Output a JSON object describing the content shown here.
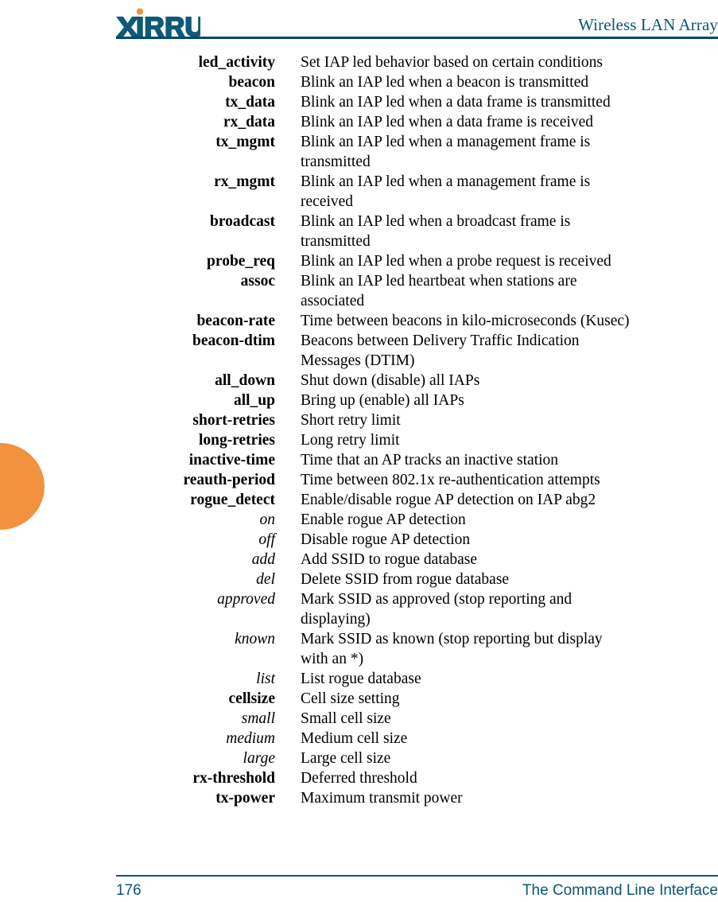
{
  "header": {
    "logo_text": "XIRRUS",
    "logo_icon": "xirrus-wordmark",
    "title": "Wireless LAN Array",
    "rule_color": "#004a63",
    "logo_color": "#0d5a77",
    "logo_dot_color": "#f2913e"
  },
  "decoration": {
    "thumb_tab_color": "#f2913e",
    "thumb_tab_name": "chapter-thumb-tab"
  },
  "content": {
    "entries": [
      {
        "term": "led_activity",
        "level": 1,
        "lines": [
          "Set IAP led behavior based on certain conditions"
        ]
      },
      {
        "term": "beacon",
        "level": 1,
        "lines": [
          "Blink an IAP led when a beacon is transmitted"
        ]
      },
      {
        "term": "tx_data",
        "level": 1,
        "lines": [
          "Blink an IAP led when a data frame is transmitted"
        ]
      },
      {
        "term": "rx_data",
        "level": 1,
        "lines": [
          "Blink an IAP led when a data frame is received"
        ]
      },
      {
        "term": "tx_mgmt",
        "level": 1,
        "lines": [
          "Blink an IAP led when a management frame is",
          "transmitted"
        ]
      },
      {
        "term": "rx_mgmt",
        "level": 1,
        "lines": [
          "Blink an IAP led when a management frame is",
          "received"
        ]
      },
      {
        "term": "broadcast",
        "level": 1,
        "lines": [
          "Blink an IAP led when a broadcast frame is",
          "transmitted"
        ]
      },
      {
        "term": "probe_req",
        "level": 1,
        "lines": [
          "Blink an IAP led when a probe request is received"
        ]
      },
      {
        "term": "assoc",
        "level": 1,
        "lines": [
          "Blink an IAP led heartbeat when stations are",
          "associated"
        ]
      },
      {
        "term": "beacon-rate",
        "level": 1,
        "lines": [
          "Time between beacons in kilo-microseconds (Kusec)"
        ]
      },
      {
        "term": "beacon-dtim",
        "level": 1,
        "lines": [
          "Beacons between Delivery Traffic Indication",
          "Messages (DTIM)"
        ]
      },
      {
        "term": "all_down",
        "level": 1,
        "lines": [
          "Shut down (disable) all IAPs"
        ]
      },
      {
        "term": "all_up",
        "level": 1,
        "lines": [
          "Bring up (enable) all IAPs"
        ]
      },
      {
        "term": "short-retries",
        "level": 1,
        "lines": [
          "Short retry limit"
        ]
      },
      {
        "term": "long-retries",
        "level": 1,
        "lines": [
          "Long retry limit"
        ]
      },
      {
        "term": "inactive-time",
        "level": 1,
        "lines": [
          "Time that an AP tracks an inactive station"
        ]
      },
      {
        "term": "reauth-period",
        "level": 1,
        "lines": [
          "Time between 802.1x re-authentication attempts"
        ]
      },
      {
        "term": "rogue_detect",
        "level": 1,
        "lines": [
          "Enable/disable rogue AP detection on IAP abg2"
        ]
      },
      {
        "term": "on",
        "level": 2,
        "lines": [
          "Enable rogue AP detection"
        ]
      },
      {
        "term": "off",
        "level": 2,
        "lines": [
          "Disable rogue AP detection"
        ]
      },
      {
        "term": "add",
        "level": 2,
        "lines": [
          "Add SSID to rogue database"
        ]
      },
      {
        "term": "del",
        "level": 2,
        "lines": [
          "Delete SSID from rogue database"
        ]
      },
      {
        "term": "approved",
        "level": 2,
        "lines": [
          "Mark SSID as approved (stop reporting and",
          "displaying)"
        ]
      },
      {
        "term": "known",
        "level": 2,
        "lines": [
          "Mark SSID as known (stop reporting but display",
          "with an *)"
        ]
      },
      {
        "term": "list",
        "level": 2,
        "lines": [
          "List rogue database"
        ]
      },
      {
        "term": "cellsize",
        "level": 1,
        "lines": [
          "Cell size setting"
        ]
      },
      {
        "term": "small",
        "level": 2,
        "lines": [
          "Small cell size"
        ]
      },
      {
        "term": "medium",
        "level": 2,
        "lines": [
          "Medium cell size"
        ]
      },
      {
        "term": "large",
        "level": 2,
        "lines": [
          "Large cell size"
        ]
      },
      {
        "term": "rx-threshold",
        "level": 1,
        "lines": [
          "Deferred threshold"
        ]
      },
      {
        "term": "tx-power",
        "level": 1,
        "lines": [
          "Maximum transmit power"
        ]
      }
    ]
  },
  "footer": {
    "page_number": "176",
    "chapter_title": "The Command Line Interface",
    "color": "#0b5573"
  }
}
